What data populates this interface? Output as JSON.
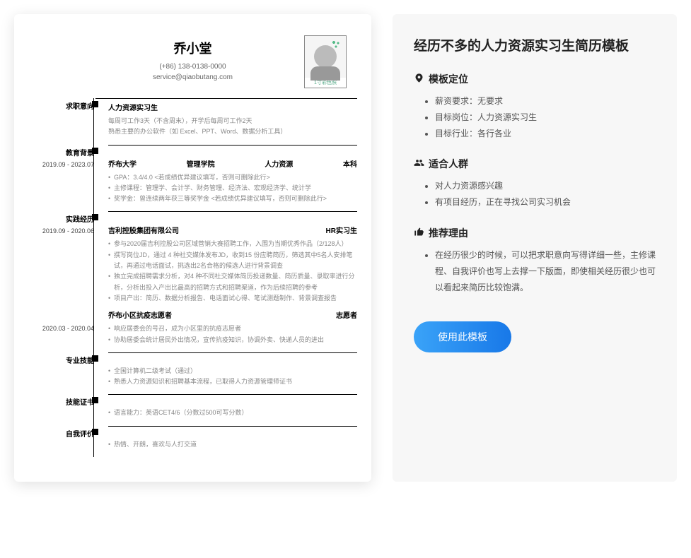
{
  "resume": {
    "name": "乔小堂",
    "phone": "(+86) 138-0138-0000",
    "email": "service@qiaobutang.com",
    "photo_caption": "1寸彩色照",
    "sections": {
      "intent": {
        "label": "求职意向",
        "title": "人力资源实习生",
        "line1": "每周可工作3天（不含周末），开学后每周可工作2天",
        "line2": "熟悉主要的办公软件（如 Excel、PPT、Word、数据分析工具）"
      },
      "education": {
        "label": "教育背景",
        "date": "2019.09 - 2023.07",
        "school": "乔布大学",
        "college": "管理学院",
        "major": "人力资源",
        "degree": "本科",
        "b1": "GPA：3.4/4.0 <若成绩优异建议填写，否则可删除此行>",
        "b2": "主修课程：管理学、会计学、财务管理、经济法、宏观经济学、统计学",
        "b3": "奖学金：曾连续两年获三等奖学金 <若成绩优异建议填写，否则可删除此行>"
      },
      "practice": {
        "label": "实践经历",
        "e1": {
          "date": "2019.09 - 2020.06",
          "org": "吉利控股集团有限公司",
          "role": "HR实习生",
          "b1": "参与2020届吉利控股公司区域营销大赛招聘工作，入围为当期优秀作品（2/128人）",
          "b2": "撰写岗位JD，通过 4 种社交媒体发布JD，收到15 份应聘简历，筛选其中5名人安排笔试，再通过电话面试，挑选出2名合格的候选人进行背景调查",
          "b3": "独立完成招聘需求分析，对4 种不同社交媒体简历投递数量、简历质量、录取率进行分析，分析出投入产出比最高的招聘方式和招聘渠道，作为后续招聘的参考",
          "b4": "项目产出：简历、数据分析报告、电话面试心得、笔试测题制作、背景调查报告"
        },
        "e2": {
          "date": "2020.03 - 2020.04",
          "org": "乔布小区抗疫志愿者",
          "role": "志愿者",
          "b1": "响应居委会的号召，成为小区里的抗疫志愿者",
          "b2": "协助居委会统计居民外出情况，宣传抗疫知识，协调外卖、快递人员的进出"
        }
      },
      "skills": {
        "label": "专业技能",
        "b1": "全国计算机二级考试（通过）",
        "b2": "熟悉人力资源知识和招聘基本流程，已取得人力资源管理师证书"
      },
      "certs": {
        "label": "技能证书",
        "b1": "语言能力：英语CET4/6（分数过500可写分数）"
      },
      "selfeval": {
        "label": "自我评价",
        "b1": "热情、开朗，喜欢与人打交道"
      }
    }
  },
  "panel": {
    "title": "经历不多的人力资源实习生简历模板",
    "positioning": {
      "heading": "模板定位",
      "i1": "薪资要求：无要求",
      "i2": "目标岗位：人力资源实习生",
      "i3": "目标行业：各行各业"
    },
    "audience": {
      "heading": "适合人群",
      "i1": "对人力资源感兴趣",
      "i2": "有项目经历，正在寻找公司实习机会"
    },
    "reason": {
      "heading": "推荐理由",
      "i1": "在经历很少的时候，可以把求职意向写得详细一些，主修课程、自我评价也写上去撑一下版面，即使相关经历很少也可以看起来简历比较饱满。"
    },
    "button": "使用此模板"
  }
}
